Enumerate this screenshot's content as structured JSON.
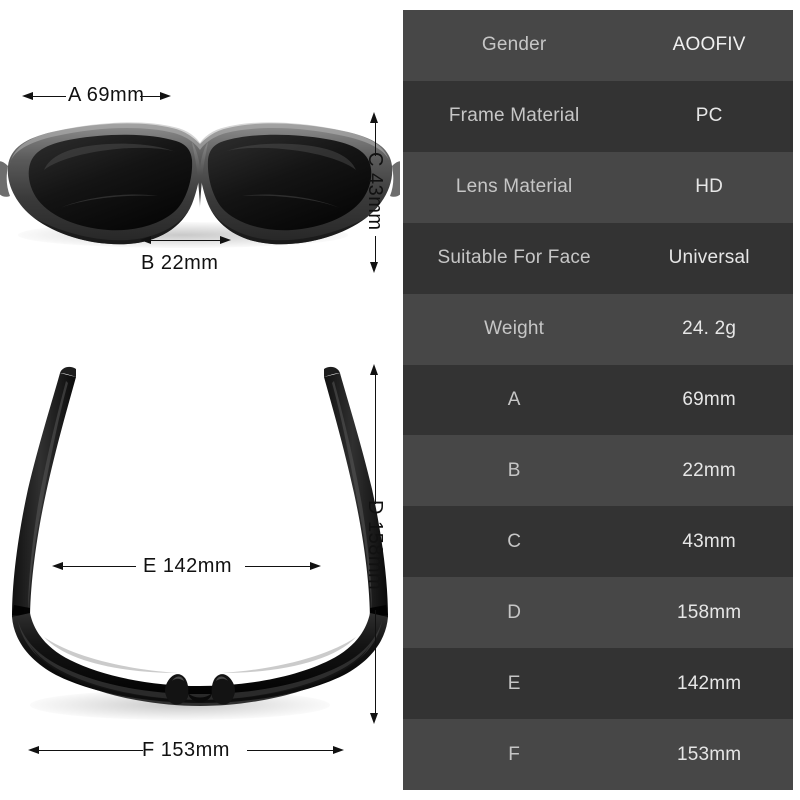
{
  "spec_table": {
    "rows": [
      {
        "key": "Gender",
        "value": "AOOFIV",
        "shade": "odd"
      },
      {
        "key": "Frame Material",
        "value": "PC",
        "shade": "even"
      },
      {
        "key": "Lens Material",
        "value": "HD",
        "shade": "odd"
      },
      {
        "key": "Suitable For Face",
        "value": "Universal",
        "shade": "even"
      },
      {
        "key": "Weight",
        "value": "24. 2g",
        "shade": "odd"
      },
      {
        "key": "A",
        "value": "69mm",
        "shade": "even"
      },
      {
        "key": "B",
        "value": "22mm",
        "shade": "odd"
      },
      {
        "key": "C",
        "value": "43mm",
        "shade": "even"
      },
      {
        "key": "D",
        "value": "158mm",
        "shade": "odd"
      },
      {
        "key": "E",
        "value": "142mm",
        "shade": "even"
      },
      {
        "key": "F",
        "value": "153mm",
        "shade": "odd"
      }
    ],
    "colors": {
      "row_light": "#474747",
      "row_dark": "#333333",
      "key_text": "#c6c6c6",
      "value_text": "#e6e6e6"
    }
  },
  "diagrams": {
    "front_view": {
      "name": "sunglasses-front-view",
      "dim_a": "A  69mm",
      "dim_b": "B  22mm",
      "dim_c": "C  43mm"
    },
    "top_view": {
      "name": "sunglasses-top-view",
      "dim_d": "D  158mm",
      "dim_e": "E  142mm",
      "dim_f": "F  153mm"
    },
    "colors": {
      "line": "#111111",
      "frame_dark": "#1a1a1a",
      "frame_gray": "#6e6e6e",
      "lens": "#111111",
      "background": "#ffffff"
    }
  }
}
